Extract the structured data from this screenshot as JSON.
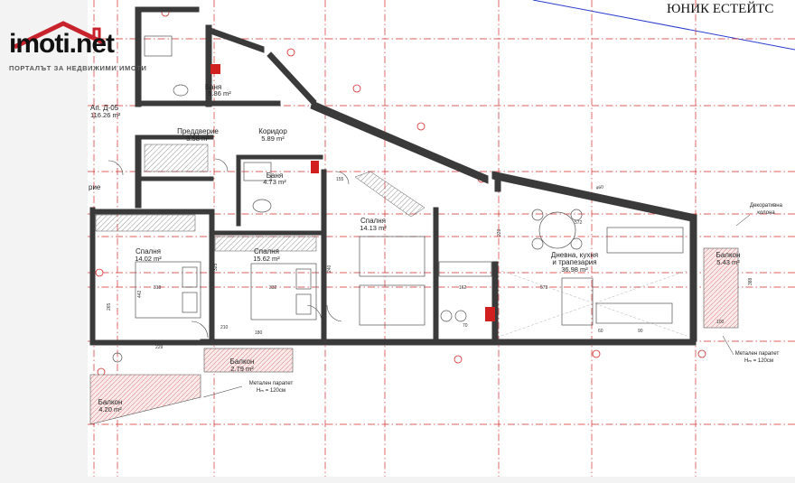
{
  "brand": {
    "logo_text": "imoti.net",
    "logo_tagline": "ПОРТАЛЪТ ЗА НЕДВИЖИМИ ИМОТИ",
    "agency": "ЮНИК ЕСТЕЙТС"
  },
  "apartment": {
    "name": "Ап. Д-05",
    "area": "116.26 m²"
  },
  "rooms": [
    {
      "id": "bath1",
      "name": "Баня",
      "area": "5.86 m²"
    },
    {
      "id": "hall",
      "name": "Преддверие",
      "area": "3.58 m²"
    },
    {
      "id": "corridor",
      "name": "Коридор",
      "area": "5.89 m²"
    },
    {
      "id": "bath2",
      "name": "Баня",
      "area": "4.73 m²"
    },
    {
      "id": "bed1",
      "name": "Спалня",
      "area": "14.02 m²"
    },
    {
      "id": "bed2",
      "name": "Спалня",
      "area": "15.62 m²"
    },
    {
      "id": "bed3",
      "name": "Спалня",
      "area": "14.13 m²"
    },
    {
      "id": "living_l1",
      "name": "Дневна, кухня",
      "area": ""
    },
    {
      "id": "living_l2",
      "name": "и трапезария",
      "area": "36.98 m²"
    },
    {
      "id": "balcony1",
      "name": "Балкон",
      "area": "5.43 m²"
    },
    {
      "id": "balcony2",
      "name": "Балкон",
      "area": "2.79 m²"
    },
    {
      "id": "balcony3",
      "name": "Балкон",
      "area": "4.20 m²"
    },
    {
      "id": "left_part",
      "name": "рие",
      "area": ""
    }
  ],
  "notes": {
    "parapet_a": "Метален парапет",
    "parapet_a_h": "Hₘ = 120см",
    "parapet_b": "Метален парапет",
    "parapet_b_h": "Hₘ = 120см",
    "column_1": "Декоративна",
    "column_2": "колона"
  },
  "dims": [
    "318",
    "332",
    "442",
    "229",
    "573",
    "388",
    "162",
    "100",
    "240",
    "220",
    "325",
    "265",
    "70",
    "60",
    "155",
    "180",
    "210",
    "90",
    "572",
    "460"
  ],
  "colors": {
    "wall": "#3a3a3a",
    "red_grid": "#d22b2b",
    "blue_line": "#2a3ccf",
    "accent": "#d11f1f",
    "hatch": "#e7b8b8"
  }
}
